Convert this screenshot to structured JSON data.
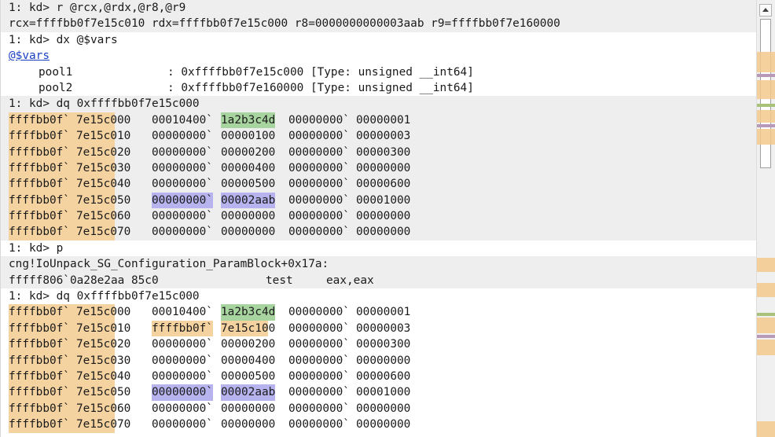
{
  "colors": {
    "address_highlight": "#f5d3a1",
    "match_green": "#a8d4a0",
    "match_blue": "#b7b3ee",
    "link": "#1b3fc4"
  },
  "lines": {
    "l1": "1: kd> r @rcx,@rdx,@r8,@r9",
    "l2": "rcx=ffffbb0f7e15c010 rdx=ffffbb0f7e15c000 r8=0000000000003aab r9=ffffbb0f7e160000",
    "l3": "1: kd> dx @$vars",
    "l4_link": "@$vars",
    "l5_name": "pool1",
    "l5_val": ": 0xffffbb0f7e15c000 [Type: unsigned __int64]",
    "l6_name": "pool2",
    "l6_val": ": 0xffffbb0f7e160000 [Type: unsigned __int64]",
    "l7": "1: kd> dq 0xffffbb0f7e15c000",
    "l16": "1: kd> p",
    "l17": "cng!IoUnpack_SG_Configuration_ParamBlock+0x17a:",
    "l18_addr": "fffff806`0a28e2aa 85c0",
    "l18_op": "test",
    "l18_args": "eax,eax",
    "l19": "1: kd> dq 0xffffbb0f7e15c000"
  },
  "dump1": [
    {
      "a1": "ffffbb0f`",
      "a2": "7e15c000",
      "q1a": "00010400`",
      "q1b": "1a2b3c4d",
      "q2a": "00000000`",
      "q2b": "00000001"
    },
    {
      "a1": "ffffbb0f`",
      "a2": "7e15c010",
      "q1a": "00000000`",
      "q1b": "00000100",
      "q2a": "00000000`",
      "q2b": "00000003"
    },
    {
      "a1": "ffffbb0f`",
      "a2": "7e15c020",
      "q1a": "00000000`",
      "q1b": "00000200",
      "q2a": "00000000`",
      "q2b": "00000300"
    },
    {
      "a1": "ffffbb0f`",
      "a2": "7e15c030",
      "q1a": "00000000`",
      "q1b": "00000400",
      "q2a": "00000000`",
      "q2b": "00000000"
    },
    {
      "a1": "ffffbb0f`",
      "a2": "7e15c040",
      "q1a": "00000000`",
      "q1b": "00000500",
      "q2a": "00000000`",
      "q2b": "00000600"
    },
    {
      "a1": "ffffbb0f`",
      "a2": "7e15c050",
      "q1a": "00000000`",
      "q1b": "00002aab",
      "q2a": "00000000`",
      "q2b": "00001000"
    },
    {
      "a1": "ffffbb0f`",
      "a2": "7e15c060",
      "q1a": "00000000`",
      "q1b": "00000000",
      "q2a": "00000000`",
      "q2b": "00000000"
    },
    {
      "a1": "ffffbb0f`",
      "a2": "7e15c070",
      "q1a": "00000000`",
      "q1b": "00000000",
      "q2a": "00000000`",
      "q2b": "00000000"
    }
  ],
  "dump2": [
    {
      "a1": "ffffbb0f`",
      "a2": "7e15c000",
      "q1a": "00010400`",
      "q1b": "1a2b3c4d",
      "q2a": "00000000`",
      "q2b": "00000001"
    },
    {
      "a1": "ffffbb0f`",
      "a2": "7e15c010",
      "q1a": "ffffbb0f`",
      "q1b": "7e15c100",
      "q2a": "00000000`",
      "q2b": "00000003"
    },
    {
      "a1": "ffffbb0f`",
      "a2": "7e15c020",
      "q1a": "00000000`",
      "q1b": "00000200",
      "q2a": "00000000`",
      "q2b": "00000300"
    },
    {
      "a1": "ffffbb0f`",
      "a2": "7e15c030",
      "q1a": "00000000`",
      "q1b": "00000400",
      "q2a": "00000000`",
      "q2b": "00000000"
    },
    {
      "a1": "ffffbb0f`",
      "a2": "7e15c040",
      "q1a": "00000000`",
      "q1b": "00000500",
      "q2a": "00000000`",
      "q2b": "00000600"
    },
    {
      "a1": "ffffbb0f`",
      "a2": "7e15c050",
      "q1a": "00000000`",
      "q1b": "00002aab",
      "q2a": "00000000`",
      "q2b": "00001000"
    },
    {
      "a1": "ffffbb0f`",
      "a2": "7e15c060",
      "q1a": "00000000`",
      "q1b": "00000000",
      "q2a": "00000000`",
      "q2b": "00000000"
    },
    {
      "a1": "ffffbb0f`",
      "a2": "7e15c070",
      "q1a": "00000000`",
      "q1b": "00000000",
      "q2a": "00000000`",
      "q2b": "00000000"
    }
  ],
  "scrollbar": {
    "up_icon": "chevron-up-icon"
  }
}
